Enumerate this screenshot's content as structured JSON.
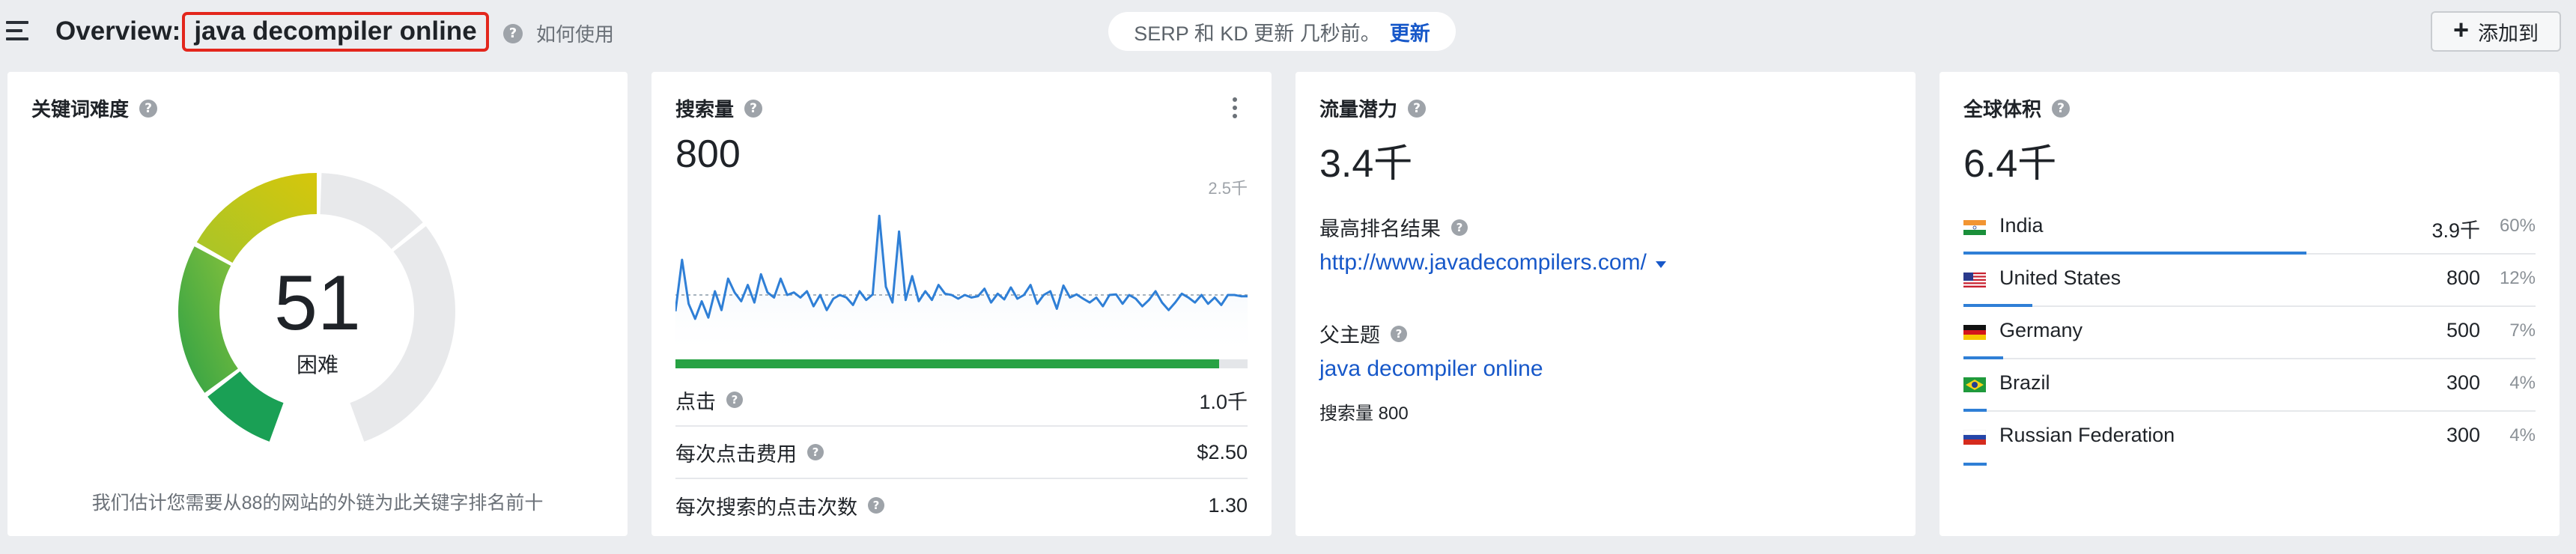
{
  "topbar": {
    "overview_label": "Overview:",
    "keyword": "java decompiler online",
    "how_to_use": "如何使用",
    "serp_notice": "SERP 和 KD 更新 几秒前。",
    "update_label": "更新",
    "add_to_label": "添加到"
  },
  "kd_card": {
    "title": "关键词难度",
    "value": "51",
    "difficulty_label": "困难",
    "note": "我们估计您需要从88的网站的外链为此关键字排名前十"
  },
  "volume_card": {
    "title": "搜索量",
    "value": "800",
    "chart_max_label": "2.5千",
    "clicks_share": 0.95,
    "rows": [
      {
        "label": "点击",
        "value": "1.0千"
      },
      {
        "label": "每次点击费用",
        "value": "$2.50"
      },
      {
        "label": "每次搜索的点击次数",
        "value": "1.30"
      }
    ]
  },
  "traffic_card": {
    "title": "流量潜力",
    "value": "3.4千",
    "top_result_label": "最高排名结果",
    "top_result_url": "http://www.javadecompilers.com/",
    "parent_topic_label": "父主题",
    "parent_topic": "java decompiler online",
    "parent_volume": "搜索量 800"
  },
  "global_card": {
    "title": "全球体积",
    "value": "6.4千",
    "countries": [
      {
        "name": "India",
        "value": "3.9千",
        "pct": "60%",
        "share": 0.6,
        "flag": "india-flag-icon"
      },
      {
        "name": "United States",
        "value": "800",
        "pct": "12%",
        "share": 0.12,
        "flag": "us-flag-icon"
      },
      {
        "name": "Germany",
        "value": "500",
        "pct": "7%",
        "share": 0.07,
        "flag": "germany-flag-icon"
      },
      {
        "name": "Brazil",
        "value": "300",
        "pct": "4%",
        "share": 0.04,
        "flag": "brazil-flag-icon"
      },
      {
        "name": "Russian Federation",
        "value": "300",
        "pct": "4%",
        "share": 0.04,
        "flag": "russia-flag-icon"
      }
    ]
  },
  "colors": {
    "accent_link": "#1758c9",
    "clicks_bar": "#27a243",
    "country_bar": "#2f7fd6",
    "highlight_box": "#e3261c"
  },
  "chart_data": {
    "type": "line",
    "x": [
      1,
      2,
      3,
      4,
      5,
      6,
      7,
      8,
      9,
      10,
      11,
      12,
      13,
      14,
      15,
      16,
      17,
      18,
      19,
      20,
      21,
      22,
      23,
      24,
      25,
      26,
      27,
      28,
      29,
      30,
      31,
      32,
      33,
      34,
      35,
      36,
      37,
      38,
      39,
      40,
      41,
      42,
      43,
      44,
      45,
      46,
      47,
      48,
      49,
      50,
      51,
      52,
      53,
      54,
      55,
      56,
      57,
      58,
      59,
      60,
      61,
      62,
      63,
      64,
      65,
      66,
      67,
      68,
      69,
      70,
      71,
      72,
      73,
      74,
      75,
      76,
      77,
      78,
      79,
      80,
      81,
      82,
      83,
      84,
      85,
      86,
      87,
      88
    ],
    "series": [
      {
        "values": [
          740,
          1560,
          860,
          620,
          900,
          640,
          1060,
          760,
          1260,
          1040,
          900,
          1160,
          880,
          1330,
          1040,
          960,
          1260,
          1000,
          1040,
          960,
          1060,
          820,
          1000,
          760,
          940,
          1000,
          960,
          840,
          1060,
          920,
          1010,
          2260,
          1130,
          880,
          2010,
          920,
          1300,
          900,
          1060,
          920,
          1160,
          1020,
          1000,
          940,
          1000,
          960,
          980,
          1100,
          880,
          1020,
          930,
          1120,
          940,
          1000,
          1160,
          860,
          1000,
          1060,
          780,
          1150,
          960,
          1010,
          940,
          880,
          960,
          820,
          1000,
          1010,
          860,
          1000,
          940,
          820,
          920,
          1060,
          880,
          760,
          880,
          1020,
          960,
          880,
          1000,
          860,
          960,
          840,
          1000,
          1000,
          980,
          980
        ]
      }
    ],
    "ylim": [
      0,
      2500
    ],
    "ylabel": "",
    "xlabel": "",
    "title": ""
  }
}
